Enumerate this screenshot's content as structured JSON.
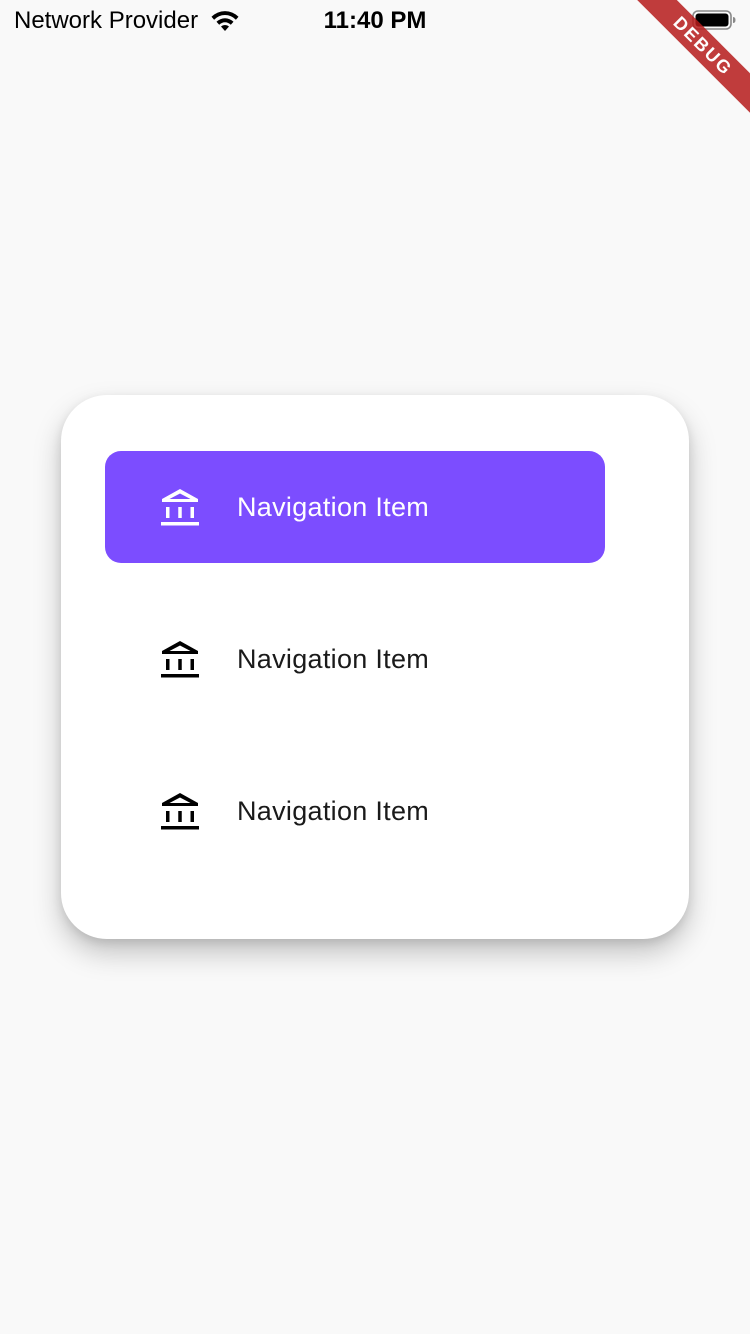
{
  "status_bar": {
    "carrier": "Network Provider",
    "time": "11:40 PM",
    "wifi_icon": "wifi-icon",
    "battery_icon": "battery-icon"
  },
  "debug_banner": {
    "label": "DEBUG",
    "color": "#b71c1c"
  },
  "navigation": {
    "accent_color": "#7c4dff",
    "items": [
      {
        "label": "Navigation Item",
        "icon": "account-balance-icon",
        "selected": true
      },
      {
        "label": "Navigation Item",
        "icon": "account-balance-icon",
        "selected": false
      },
      {
        "label": "Navigation Item",
        "icon": "account-balance-icon",
        "selected": false
      }
    ]
  }
}
